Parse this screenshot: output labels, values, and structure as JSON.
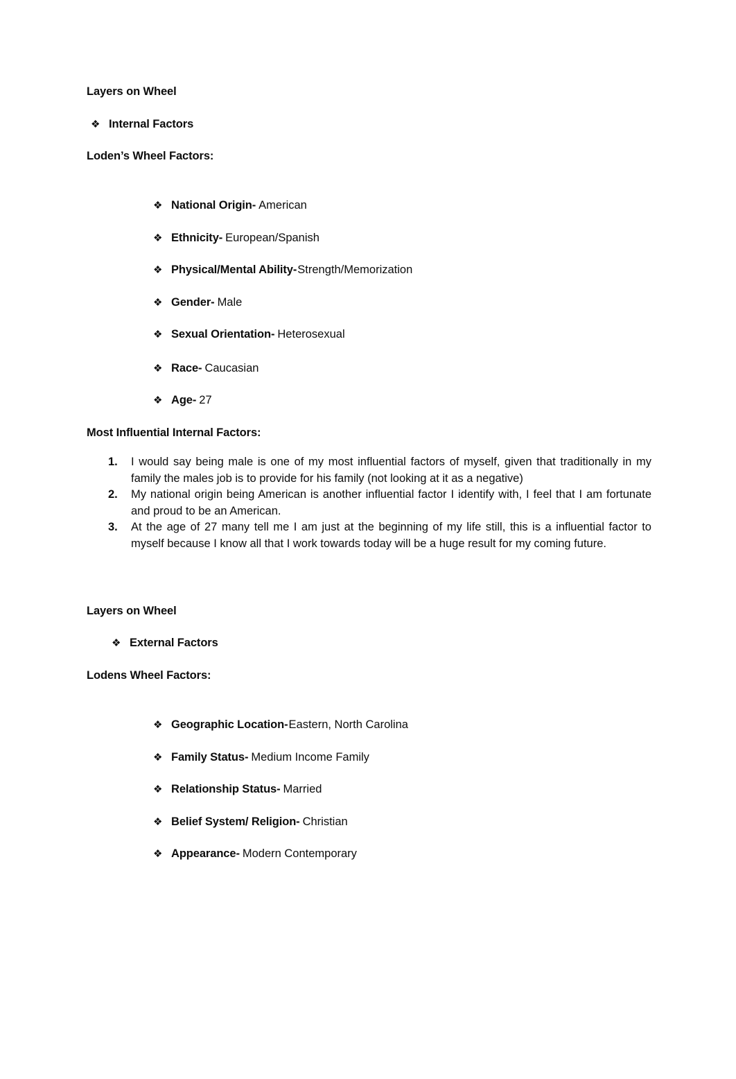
{
  "document": {
    "background_color": "#ffffff",
    "text_color": "#0d0d0d",
    "bullet_glyph": "❖"
  },
  "section_internal": {
    "heading": "Layers on Wheel",
    "subheading": "Internal Factors",
    "factors_heading": "Loden’s Wheel Factors:",
    "factors": [
      {
        "label": "National Origin-",
        "value": "American"
      },
      {
        "label": "Ethnicity-",
        "value": "European/Spanish"
      },
      {
        "label": "Physical/Mental Ability-",
        "value": "Strength/Memorization"
      },
      {
        "label": "Gender-",
        "value": "Male"
      },
      {
        "label": "Sexual Orientation-",
        "value": "Heterosexual"
      },
      {
        "label": "Race-",
        "value": "Caucasian"
      },
      {
        "label": "Age-",
        "value": "27"
      }
    ],
    "influential_heading": "Most Influential Internal Factors:",
    "influential_items": [
      {
        "number": "1.",
        "text": "I would say being male is one of my most influential factors of myself, given that traditionally in my family the males job is to provide for his family (not looking at it as a negative)"
      },
      {
        "number": "2.",
        "text": "My national origin being American is another influential factor I identify with, I feel that I am fortunate and proud to be an American."
      },
      {
        "number": "3.",
        "text": "At the age of 27 many tell me I am just at the beginning of my life still, this is a influential factor to myself because I know all that I work towards today will be a huge result for my coming future."
      }
    ]
  },
  "section_external": {
    "heading": "Layers on Wheel",
    "subheading": "External Factors",
    "factors_heading": "Lodens Wheel Factors:",
    "factors": [
      {
        "label": "Geographic Location-",
        "value": "Eastern, North Carolina"
      },
      {
        "label": "Family Status-",
        "value": "Medium Income Family"
      },
      {
        "label": "Relationship Status-",
        "value": "Married"
      },
      {
        "label": "Belief System/ Religion-",
        "value": "Christian"
      },
      {
        "label": "Appearance-",
        "value": "Modern Contemporary"
      }
    ]
  }
}
